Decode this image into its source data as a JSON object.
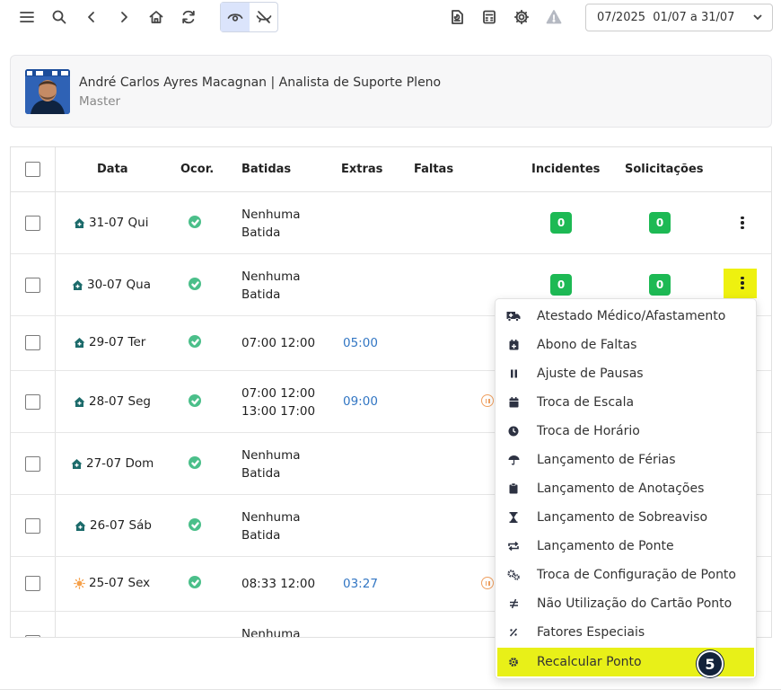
{
  "toolbar": {
    "icons": [
      "menu-icon",
      "search-icon",
      "back-icon",
      "forward-icon",
      "home-icon",
      "refresh-icon",
      "eye-icon",
      "eye-off-icon",
      "report-icon",
      "calculator-icon",
      "gear-icon",
      "warning-icon",
      "chevron-down-icon"
    ],
    "period": "07/2025  01/07 a 31/07"
  },
  "user": {
    "name": "André Carlos Ayres Macagnan | Analista de Suporte Pleno",
    "role": "Master"
  },
  "table": {
    "headers": {
      "data": "Data",
      "ocor": "Ocor.",
      "batidas": "Batidas",
      "extras": "Extras",
      "faltas": "Faltas",
      "incidentes": "Incidentes",
      "solicitacoes": "Solicitações"
    },
    "rows": [
      {
        "date": "31-07 Qui",
        "icon": "home-icon",
        "batida1": "Nenhuma",
        "batida2": "Batida",
        "extras": "",
        "incidentes": "0",
        "solicitacoes": "0"
      },
      {
        "date": "30-07 Qua",
        "icon": "home-icon",
        "batida1": "Nenhuma",
        "batida2": "Batida",
        "extras": "",
        "incidentes": "0",
        "solicitacoes": "0"
      },
      {
        "date": "29-07 Ter",
        "icon": "home-icon",
        "batida1": "07:00 12:00",
        "batida2": "",
        "extras": "05:00"
      },
      {
        "date": "28-07 Seg",
        "icon": "home-icon",
        "batida1": "07:00 12:00",
        "batida2": "13:00 17:00",
        "extras": "09:00"
      },
      {
        "date": "27-07 Dom",
        "icon": "home-icon",
        "batida1": "Nenhuma",
        "batida2": "Batida",
        "extras": ""
      },
      {
        "date": "26-07 Sáb",
        "icon": "home-icon",
        "batida1": "Nenhuma",
        "batida2": "Batida",
        "extras": ""
      },
      {
        "date": "25-07 Sex",
        "icon": "sun-icon",
        "batida1": "08:33 12:00",
        "batida2": "",
        "extras": "03:27"
      },
      {
        "date": "",
        "icon": "",
        "batida1": "Nenhuma",
        "batida2": "",
        "extras": ""
      }
    ]
  },
  "menu": {
    "items": [
      {
        "label": "Atestado Médico/Afastamento",
        "icon": "ambulance-icon"
      },
      {
        "label": "Abono de Faltas",
        "icon": "calendar-plus-icon"
      },
      {
        "label": "Ajuste de Pausas",
        "icon": "pause-icon"
      },
      {
        "label": "Troca de Escala",
        "icon": "calendar-icon"
      },
      {
        "label": "Troca de Horário",
        "icon": "clock-icon"
      },
      {
        "label": "Lançamento de Férias",
        "icon": "umbrella-icon"
      },
      {
        "label": "Lançamento de Anotações",
        "icon": "clipboard-icon"
      },
      {
        "label": "Lançamento de Sobreaviso",
        "icon": "hourglass-icon"
      },
      {
        "label": "Lançamento de Ponte",
        "icon": "repeat-icon"
      },
      {
        "label": "Troca de Configuração de Ponto",
        "icon": "cogs-icon"
      },
      {
        "label": "Não Utilização do Cartão Ponto",
        "icon": "not-equal-icon"
      },
      {
        "label": "Fatores Especiais",
        "icon": "percent-icon"
      },
      {
        "label": "Recalcular Ponto",
        "icon": "gear-icon"
      }
    ],
    "step_number": "5"
  },
  "colors": {
    "highlight": "#e8f018",
    "badge_green": "#1db954",
    "ocor_green": "#4bbf8a",
    "extras_blue": "#3276c3",
    "home_teal": "#1c6b6b",
    "sun_orange": "#f5a04a",
    "step_navy": "#12223a"
  }
}
